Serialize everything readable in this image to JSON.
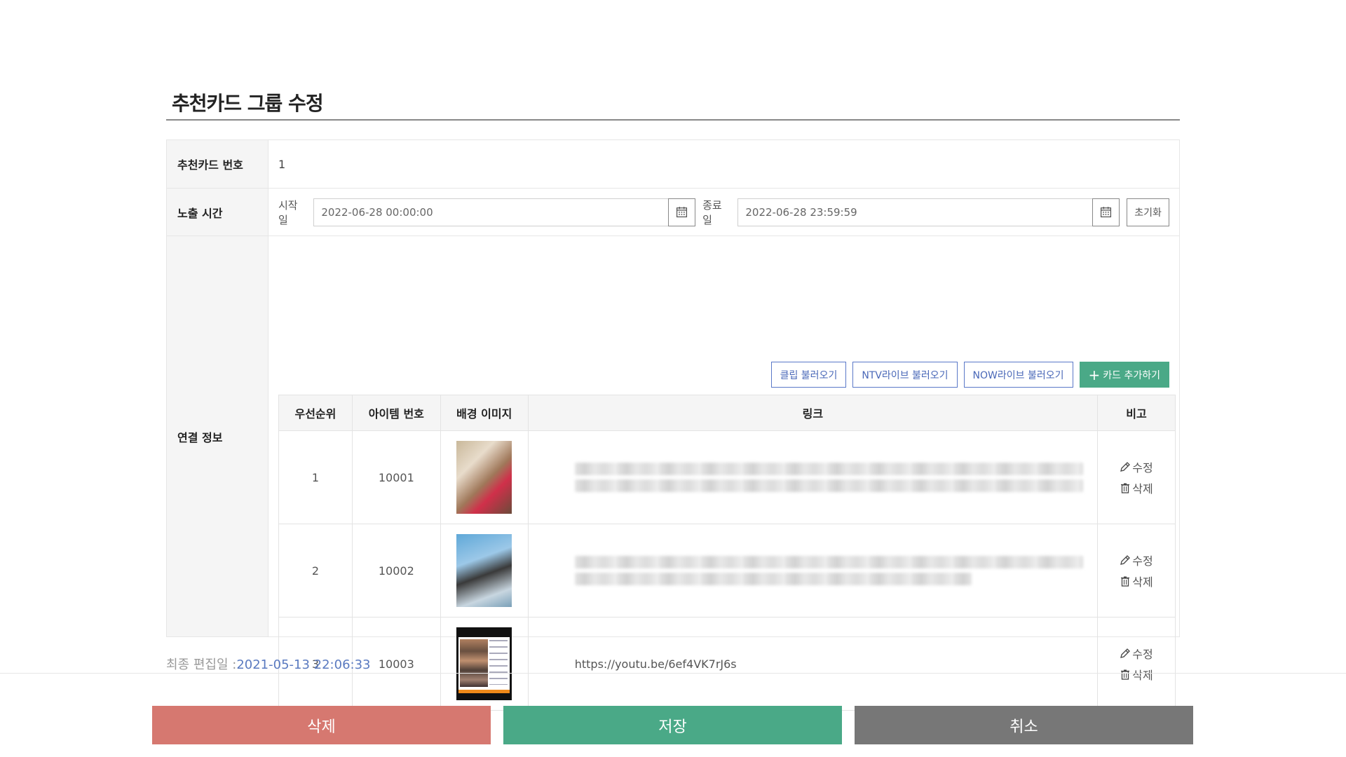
{
  "page": {
    "title": "추천카드 그룹 수정"
  },
  "fields": {
    "number_label": "추천카드 번호",
    "number_value": "1",
    "time_label": "노출 시간",
    "start_label": "시작일",
    "start_value": "2022-06-28 00:00:00",
    "end_label": "종료일",
    "end_value": "2022-06-28 23:59:59",
    "reset_label": "초기화",
    "link_label": "연결 정보"
  },
  "toolbar": {
    "clip_label": "클립 불러오기",
    "ntv_label": "NTV라이브 불러오기",
    "now_label": "NOW라이브 불러오기",
    "add_label": "카드 추가하기"
  },
  "table": {
    "headers": {
      "priority": "우선순위",
      "item": "아이템 번호",
      "image": "배경 이미지",
      "link": "링크",
      "note": "비고"
    },
    "rows": [
      {
        "priority": "1",
        "item": "10001",
        "link": "",
        "edit": "수정",
        "delete": "삭제"
      },
      {
        "priority": "2",
        "item": "10002",
        "link": "",
        "edit": "수정",
        "delete": "삭제"
      },
      {
        "priority": "3",
        "item": "10003",
        "link": "https://youtu.be/6ef4VK7rJ6s",
        "edit": "수정",
        "delete": "삭제"
      }
    ]
  },
  "footer": {
    "updated_label": "최종 편집일 :",
    "updated_value": "2021-05-13 22:06:33",
    "delete_label": "삭제",
    "save_label": "저장",
    "cancel_label": "취소"
  },
  "colors": {
    "save": "#4aa987",
    "delete": "#d67870",
    "cancel": "#777777",
    "accent": "#5a78c8"
  }
}
